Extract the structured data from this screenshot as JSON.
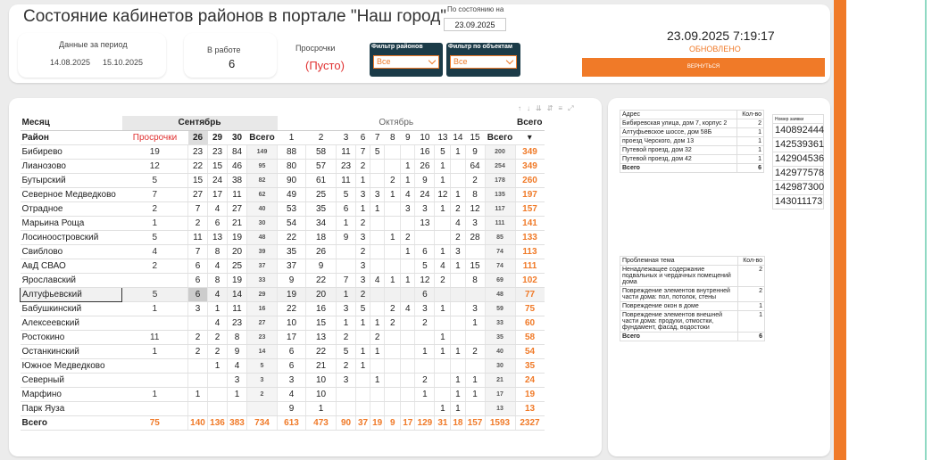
{
  "header": {
    "title": "Состояние кабинетов районов  в  портале \"Наш город\"",
    "state_label": "По состоянию на",
    "state_date": "23.09.2025"
  },
  "period": {
    "label": "Данные за период",
    "from": "14.08.2025",
    "to": "15.10.2025"
  },
  "kpi": {
    "inwork_label": "В работе",
    "inwork_value": "6",
    "overdue_label": "Просрочки",
    "overdue_value": "(Пусто)"
  },
  "filters": {
    "districts_label": "Фильтр районов",
    "districts_value": "Все",
    "objects_label": "Фильтр по объектам",
    "objects_value": "Все"
  },
  "status": {
    "datetime": "23.09.2025 7:19:17",
    "updated": "ОБНОВЛЕНО",
    "back_label": "ВЕРНУТЬСЯ"
  },
  "colors": {
    "accent": "#f07a28",
    "navy": "#1b3b48"
  },
  "main_table": {
    "h_month": "Месяц",
    "h_district": "Район",
    "h_overdue": "Просрочки",
    "h_total": "Всего",
    "sep_label": "Сентябрь",
    "oct_label": "Октябрь",
    "grand_label": "Всего",
    "sep_days": [
      "26",
      "29",
      "30",
      "Всего"
    ],
    "oct_days": [
      "1",
      "2",
      "3",
      "6",
      "7",
      "8",
      "9",
      "10",
      "13",
      "14",
      "15",
      "Всего"
    ],
    "rows": [
      {
        "name": "Бибирево",
        "p": "19",
        "s": [
          "23",
          "23",
          "84"
        ],
        "st": "149",
        "o": [
          "88",
          "58",
          "11",
          "7",
          "5",
          "",
          "",
          "16",
          "5",
          "1",
          "9"
        ],
        "ot": "200",
        "t": "349"
      },
      {
        "name": "Лианозово",
        "p": "12",
        "s": [
          "22",
          "15",
          "46"
        ],
        "st": "95",
        "o": [
          "80",
          "57",
          "23",
          "2",
          "",
          "",
          "1",
          "26",
          "1",
          "",
          "64"
        ],
        "ot": "254",
        "t": "349"
      },
      {
        "name": "Бутырский",
        "p": "5",
        "s": [
          "15",
          "24",
          "38"
        ],
        "st": "82",
        "o": [
          "90",
          "61",
          "11",
          "1",
          "",
          "2",
          "1",
          "9",
          "1",
          "",
          "2"
        ],
        "ot": "178",
        "t": "260"
      },
      {
        "name": "Северное Медведково",
        "p": "7",
        "s": [
          "27",
          "17",
          "11"
        ],
        "st": "62",
        "o": [
          "49",
          "25",
          "5",
          "3",
          "3",
          "1",
          "4",
          "24",
          "12",
          "1",
          "8"
        ],
        "ot": "135",
        "t": "197"
      },
      {
        "name": "Отрадное",
        "p": "2",
        "s": [
          "7",
          "4",
          "27"
        ],
        "st": "40",
        "o": [
          "53",
          "35",
          "6",
          "1",
          "1",
          "",
          "3",
          "3",
          "1",
          "2",
          "12"
        ],
        "ot": "117",
        "t": "157"
      },
      {
        "name": "Марьина Роща",
        "p": "1",
        "s": [
          "2",
          "6",
          "21"
        ],
        "st": "30",
        "o": [
          "54",
          "34",
          "1",
          "2",
          "",
          "",
          "",
          "13",
          "",
          "4",
          "3"
        ],
        "ot": "111",
        "t": "141"
      },
      {
        "name": "Лосиноостровский",
        "p": "5",
        "s": [
          "11",
          "13",
          "19"
        ],
        "st": "48",
        "o": [
          "22",
          "18",
          "9",
          "3",
          "",
          "1",
          "2",
          "",
          "",
          "2",
          "28"
        ],
        "ot": "85",
        "t": "133"
      },
      {
        "name": "Свиблово",
        "p": "4",
        "s": [
          "7",
          "8",
          "20"
        ],
        "st": "39",
        "o": [
          "35",
          "26",
          "",
          "2",
          "",
          "",
          "1",
          "6",
          "1",
          "3",
          ""
        ],
        "ot": "74",
        "t": "113"
      },
      {
        "name": "АвД СВАО",
        "p": "2",
        "s": [
          "6",
          "4",
          "25"
        ],
        "st": "37",
        "o": [
          "37",
          "9",
          "",
          "3",
          "",
          "",
          "",
          "5",
          "4",
          "1",
          "15"
        ],
        "ot": "74",
        "t": "111"
      },
      {
        "name": "Ярославский",
        "p": "",
        "s": [
          "6",
          "8",
          "19"
        ],
        "st": "33",
        "o": [
          "9",
          "22",
          "7",
          "3",
          "4",
          "1",
          "1",
          "12",
          "2",
          "",
          "8"
        ],
        "ot": "69",
        "t": "102"
      },
      {
        "name": "Алтуфьевский",
        "p": "5",
        "s": [
          "6",
          "4",
          "14"
        ],
        "st": "29",
        "o": [
          "19",
          "20",
          "1",
          "2",
          "",
          "",
          "",
          "6",
          "",
          "",
          ""
        ],
        "ot": "48",
        "t": "77",
        "sel": true
      },
      {
        "name": "Бабушкинский",
        "p": "1",
        "s": [
          "3",
          "1",
          "11"
        ],
        "st": "16",
        "o": [
          "22",
          "16",
          "3",
          "5",
          "",
          "2",
          "4",
          "3",
          "1",
          "",
          "3"
        ],
        "ot": "59",
        "t": "75"
      },
      {
        "name": "Алексеевский",
        "p": "",
        "s": [
          "",
          "4",
          "23"
        ],
        "st": "27",
        "o": [
          "10",
          "15",
          "1",
          "1",
          "1",
          "2",
          "",
          "2",
          "",
          "",
          "1"
        ],
        "ot": "33",
        "t": "60"
      },
      {
        "name": "Ростокино",
        "p": "11",
        "s": [
          "2",
          "2",
          "8"
        ],
        "st": "23",
        "o": [
          "17",
          "13",
          "2",
          "",
          "2",
          "",
          "",
          "",
          "1",
          "",
          ""
        ],
        "ot": "35",
        "t": "58"
      },
      {
        "name": "Останкинский",
        "p": "1",
        "s": [
          "2",
          "2",
          "9"
        ],
        "st": "14",
        "o": [
          "6",
          "22",
          "5",
          "1",
          "1",
          "",
          "",
          "1",
          "1",
          "1",
          "2"
        ],
        "ot": "40",
        "t": "54"
      },
      {
        "name": "Южное Медведково",
        "p": "",
        "s": [
          "",
          "1",
          "4"
        ],
        "st": "5",
        "o": [
          "6",
          "21",
          "2",
          "1",
          "",
          "",
          "",
          "",
          "",
          "",
          ""
        ],
        "ot": "30",
        "t": "35"
      },
      {
        "name": "Северный",
        "p": "",
        "s": [
          "",
          "",
          "3"
        ],
        "st": "3",
        "o": [
          "3",
          "10",
          "3",
          "",
          "1",
          "",
          "",
          "2",
          "",
          "1",
          "1"
        ],
        "ot": "21",
        "t": "24"
      },
      {
        "name": "Марфино",
        "p": "1",
        "s": [
          "1",
          "",
          "1"
        ],
        "st": "2",
        "o": [
          "4",
          "10",
          "",
          "",
          "",
          "",
          "",
          "1",
          "",
          "1",
          "1"
        ],
        "ot": "17",
        "t": "19"
      },
      {
        "name": "Парк Яуза",
        "p": "",
        "s": [
          "",
          "",
          "",
          "",
          ""
        ],
        "st": "",
        "o": [
          "9",
          "1",
          "",
          "",
          "",
          "",
          "",
          "",
          "1",
          "1",
          ""
        ],
        "ot": "13",
        "t": "13"
      }
    ],
    "total": {
      "name": "Всего",
      "p": "75",
      "s": [
        "140",
        "136",
        "383"
      ],
      "st": "734",
      "o": [
        "613",
        "473",
        "90",
        "37",
        "19",
        "9",
        "17",
        "129",
        "31",
        "18",
        "157"
      ],
      "ot": "1593",
      "t": "2327"
    }
  },
  "address_table": {
    "h_addr": "Адрес",
    "h_count": "Кол-во",
    "rows": [
      {
        "a": "Бибиревская улица, дом 7, корпус 2",
        "c": "2"
      },
      {
        "a": "Алтуфьевское шоссе, дом 58Б",
        "c": "1"
      },
      {
        "a": "проезд Черского, дом 13",
        "c": "1"
      },
      {
        "a": "Путевой проезд, дом 32",
        "c": "1"
      },
      {
        "a": "Путевой проезд, дом 42",
        "c": "1"
      }
    ],
    "total_label": "Всего",
    "total": "6"
  },
  "request_list": {
    "header": "Номер заявки",
    "items": [
      "140892444",
      "142539361",
      "142904536",
      "142977578",
      "142987300",
      "143011173"
    ]
  },
  "topic_table": {
    "h_topic": "Проблемная тема",
    "h_count": "Кол-во",
    "rows": [
      {
        "a": "Ненадлежащее содержание подвальных и чердачных помещений дома",
        "c": "2"
      },
      {
        "a": "Повреждение элементов внутренней части дома: пол, потолок, стены",
        "c": "2"
      },
      {
        "a": "Повреждение окон в доме",
        "c": "1"
      },
      {
        "a": "Повреждение элементов внешней части дома: продухи, отмостки, фундамент, фасад, водостоки",
        "c": "1"
      }
    ],
    "total_label": "Всего",
    "total": "6"
  }
}
